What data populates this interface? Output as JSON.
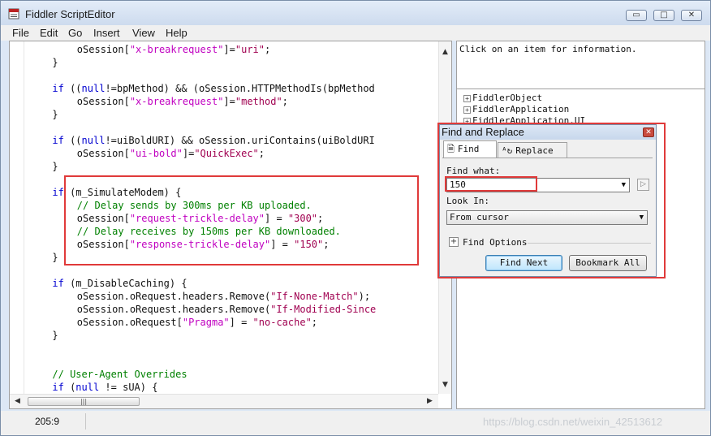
{
  "window": {
    "title": "Fiddler ScriptEditor",
    "controls": {
      "minimize": "▭",
      "maximize": "□",
      "close": "✕"
    }
  },
  "menu": [
    "File",
    "Edit",
    "Go",
    "Insert",
    "View",
    "Help"
  ],
  "code_lines": [
    {
      "indent": 4,
      "segments": [
        {
          "t": "oSession[",
          "c": ""
        },
        {
          "t": "\"x-breakrequest\"",
          "c": "str"
        },
        {
          "t": "]=",
          "c": ""
        },
        {
          "t": "\"uri\"",
          "c": "str2"
        },
        {
          "t": ";",
          "c": ""
        }
      ]
    },
    {
      "indent": 2,
      "segments": [
        {
          "t": "}",
          "c": ""
        }
      ]
    },
    {
      "indent": 0,
      "segments": []
    },
    {
      "indent": 2,
      "segments": [
        {
          "t": "if",
          "c": "kw"
        },
        {
          "t": " ((",
          "c": ""
        },
        {
          "t": "null",
          "c": "kw"
        },
        {
          "t": "!=bpMethod) && (oSession.HTTPMethodIs(bpMethod",
          "c": ""
        }
      ]
    },
    {
      "indent": 4,
      "segments": [
        {
          "t": "oSession[",
          "c": ""
        },
        {
          "t": "\"x-breakrequest\"",
          "c": "str"
        },
        {
          "t": "]=",
          "c": ""
        },
        {
          "t": "\"method\"",
          "c": "str2"
        },
        {
          "t": ";",
          "c": ""
        }
      ]
    },
    {
      "indent": 2,
      "segments": [
        {
          "t": "}",
          "c": ""
        }
      ]
    },
    {
      "indent": 0,
      "segments": []
    },
    {
      "indent": 2,
      "segments": [
        {
          "t": "if",
          "c": "kw"
        },
        {
          "t": " ((",
          "c": ""
        },
        {
          "t": "null",
          "c": "kw"
        },
        {
          "t": "!=uiBoldURI) && oSession.uriContains(uiBoldURI",
          "c": ""
        }
      ]
    },
    {
      "indent": 4,
      "segments": [
        {
          "t": "oSession[",
          "c": ""
        },
        {
          "t": "\"ui-bold\"",
          "c": "str"
        },
        {
          "t": "]=",
          "c": ""
        },
        {
          "t": "\"QuickExec\"",
          "c": "str2"
        },
        {
          "t": ";",
          "c": ""
        }
      ]
    },
    {
      "indent": 2,
      "segments": [
        {
          "t": "}",
          "c": ""
        }
      ]
    },
    {
      "indent": 0,
      "segments": []
    },
    {
      "indent": 2,
      "segments": [
        {
          "t": "if",
          "c": "kw"
        },
        {
          "t": " (m_SimulateModem) {",
          "c": ""
        }
      ]
    },
    {
      "indent": 4,
      "segments": [
        {
          "t": "// Delay sends by 300ms per KB uploaded.",
          "c": "cm"
        }
      ]
    },
    {
      "indent": 4,
      "segments": [
        {
          "t": "oSession[",
          "c": ""
        },
        {
          "t": "\"request-trickle-delay\"",
          "c": "str"
        },
        {
          "t": "] = ",
          "c": ""
        },
        {
          "t": "\"300\"",
          "c": "str2"
        },
        {
          "t": ";",
          "c": ""
        }
      ]
    },
    {
      "indent": 4,
      "segments": [
        {
          "t": "// Delay receives by 150ms per KB downloaded.",
          "c": "cm"
        }
      ]
    },
    {
      "indent": 4,
      "segments": [
        {
          "t": "oSession[",
          "c": ""
        },
        {
          "t": "\"response-trickle-delay\"",
          "c": "str"
        },
        {
          "t": "] = ",
          "c": ""
        },
        {
          "t": "\"150\"",
          "c": "str2"
        },
        {
          "t": ";",
          "c": ""
        }
      ]
    },
    {
      "indent": 2,
      "segments": [
        {
          "t": "}",
          "c": ""
        }
      ]
    },
    {
      "indent": 0,
      "segments": []
    },
    {
      "indent": 2,
      "segments": [
        {
          "t": "if",
          "c": "kw"
        },
        {
          "t": " (m_DisableCaching) {",
          "c": ""
        }
      ]
    },
    {
      "indent": 4,
      "segments": [
        {
          "t": "oSession.oRequest.headers.Remove(",
          "c": ""
        },
        {
          "t": "\"If-None-Match\"",
          "c": "str2"
        },
        {
          "t": ");",
          "c": ""
        }
      ]
    },
    {
      "indent": 4,
      "segments": [
        {
          "t": "oSession.oRequest.headers.Remove(",
          "c": ""
        },
        {
          "t": "\"If-Modified-Since",
          "c": "str2"
        }
      ]
    },
    {
      "indent": 4,
      "segments": [
        {
          "t": "oSession.oRequest[",
          "c": ""
        },
        {
          "t": "\"Pragma\"",
          "c": "str"
        },
        {
          "t": "] = ",
          "c": ""
        },
        {
          "t": "\"no-cache\"",
          "c": "str2"
        },
        {
          "t": ";",
          "c": ""
        }
      ]
    },
    {
      "indent": 2,
      "segments": [
        {
          "t": "}",
          "c": ""
        }
      ]
    },
    {
      "indent": 0,
      "segments": []
    },
    {
      "indent": 0,
      "segments": []
    },
    {
      "indent": 2,
      "segments": [
        {
          "t": "// User-Agent Overrides",
          "c": "cm"
        }
      ]
    },
    {
      "indent": 2,
      "segments": [
        {
          "t": "if",
          "c": "kw"
        },
        {
          "t": " (",
          "c": ""
        },
        {
          "t": "null",
          "c": "kw"
        },
        {
          "t": " != sUA) {",
          "c": ""
        }
      ]
    }
  ],
  "info_panel": {
    "text": "Click on an item for information."
  },
  "tree": [
    "FiddlerObject",
    "FiddlerApplication",
    "FiddlerApplication.UI"
  ],
  "find_replace": {
    "title": "Find and Replace",
    "tab_find": "Find",
    "tab_replace": "Replace",
    "find_what_label": "Find what:",
    "find_what_value": "150",
    "look_in_label": "Look In:",
    "look_in_value": "From cursor",
    "find_options_label": "Find Options",
    "find_next_label": "Find Next",
    "bookmark_all_label": "Bookmark All"
  },
  "status": {
    "position": "205:9",
    "watermark": "https://blog.csdn.net/weixin_42513612"
  }
}
